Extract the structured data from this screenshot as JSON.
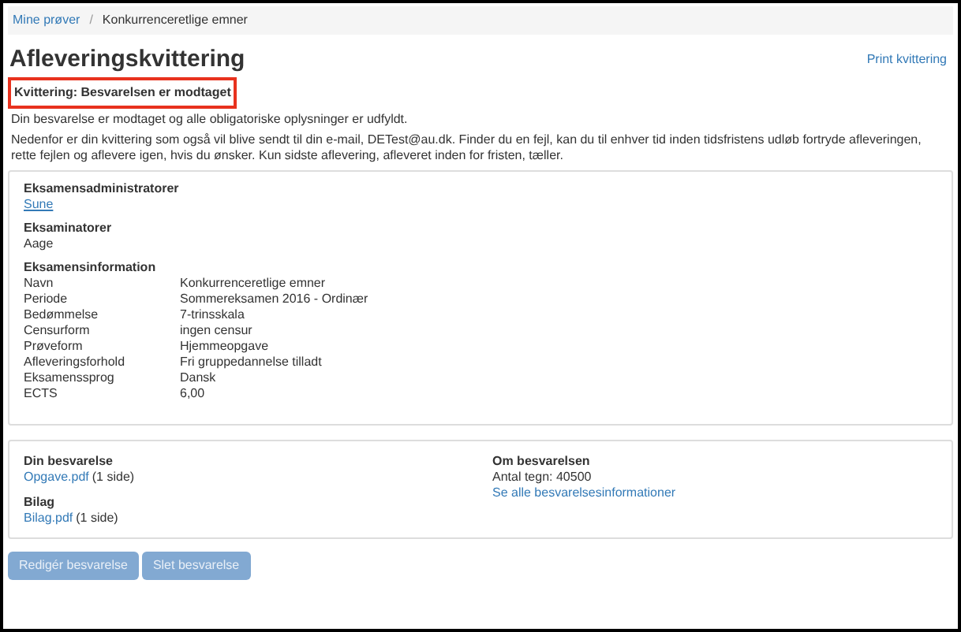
{
  "breadcrumb": [
    {
      "label": "Mine prøver",
      "link": true
    },
    {
      "label": "Konkurrenceretlige emner",
      "link": false
    }
  ],
  "breadcrumb_separator": "/",
  "title": "Afleveringskvittering",
  "print_link": "Print kvittering",
  "receipt_heading": "Kvittering: Besvarelsen er modtaget",
  "paragraphs": [
    "Din besvarelse er modtaget og alle obligatoriske oplysninger er udfyldt.",
    "Nedenfor er din kvittering som også vil blive sendt til din e-mail, DETest@au.dk. Finder du en fejl, kan du til enhver tid inden tidsfristens udløb fortryde afleveringen, rette fejlen og aflevere igen, hvis du ønsker. Kun sidste aflevering, afleveret inden for fristen, tæller."
  ],
  "admins": {
    "heading": "Eksamensadministratorer",
    "name": "Sune"
  },
  "examiners": {
    "heading": "Eksaminatorer",
    "name": "Aage"
  },
  "exam_info": {
    "heading": "Eksamensinformation",
    "rows": [
      {
        "label": "Navn",
        "value": "Konkurrenceretlige emner"
      },
      {
        "label": "Periode",
        "value": "Sommereksamen 2016 - Ordinær"
      },
      {
        "label": "Bedømmelse",
        "value": "7-trinsskala"
      },
      {
        "label": "Censurform",
        "value": "ingen censur"
      },
      {
        "label": "Prøveform",
        "value": "Hjemmeopgave"
      },
      {
        "label": "Afleveringsforhold",
        "value": "Fri gruppedannelse tilladt"
      },
      {
        "label": "Eksamenssprog",
        "value": "Dansk"
      },
      {
        "label": "ECTS",
        "value": "6,00"
      }
    ]
  },
  "submission": {
    "heading": "Din besvarelse",
    "file": "Opgave.pdf",
    "pages": "(1 side)"
  },
  "attachments": {
    "heading": "Bilag",
    "file": "Bilag.pdf",
    "pages": "(1 side)"
  },
  "about": {
    "heading": "Om besvarelsen",
    "chars": "Antal tegn: 40500",
    "link": "Se alle besvarelsesinformationer"
  },
  "buttons": [
    {
      "label": "Redigér besvarelse",
      "disabled": true
    },
    {
      "label": "Slet besvarelse",
      "disabled": true
    }
  ]
}
